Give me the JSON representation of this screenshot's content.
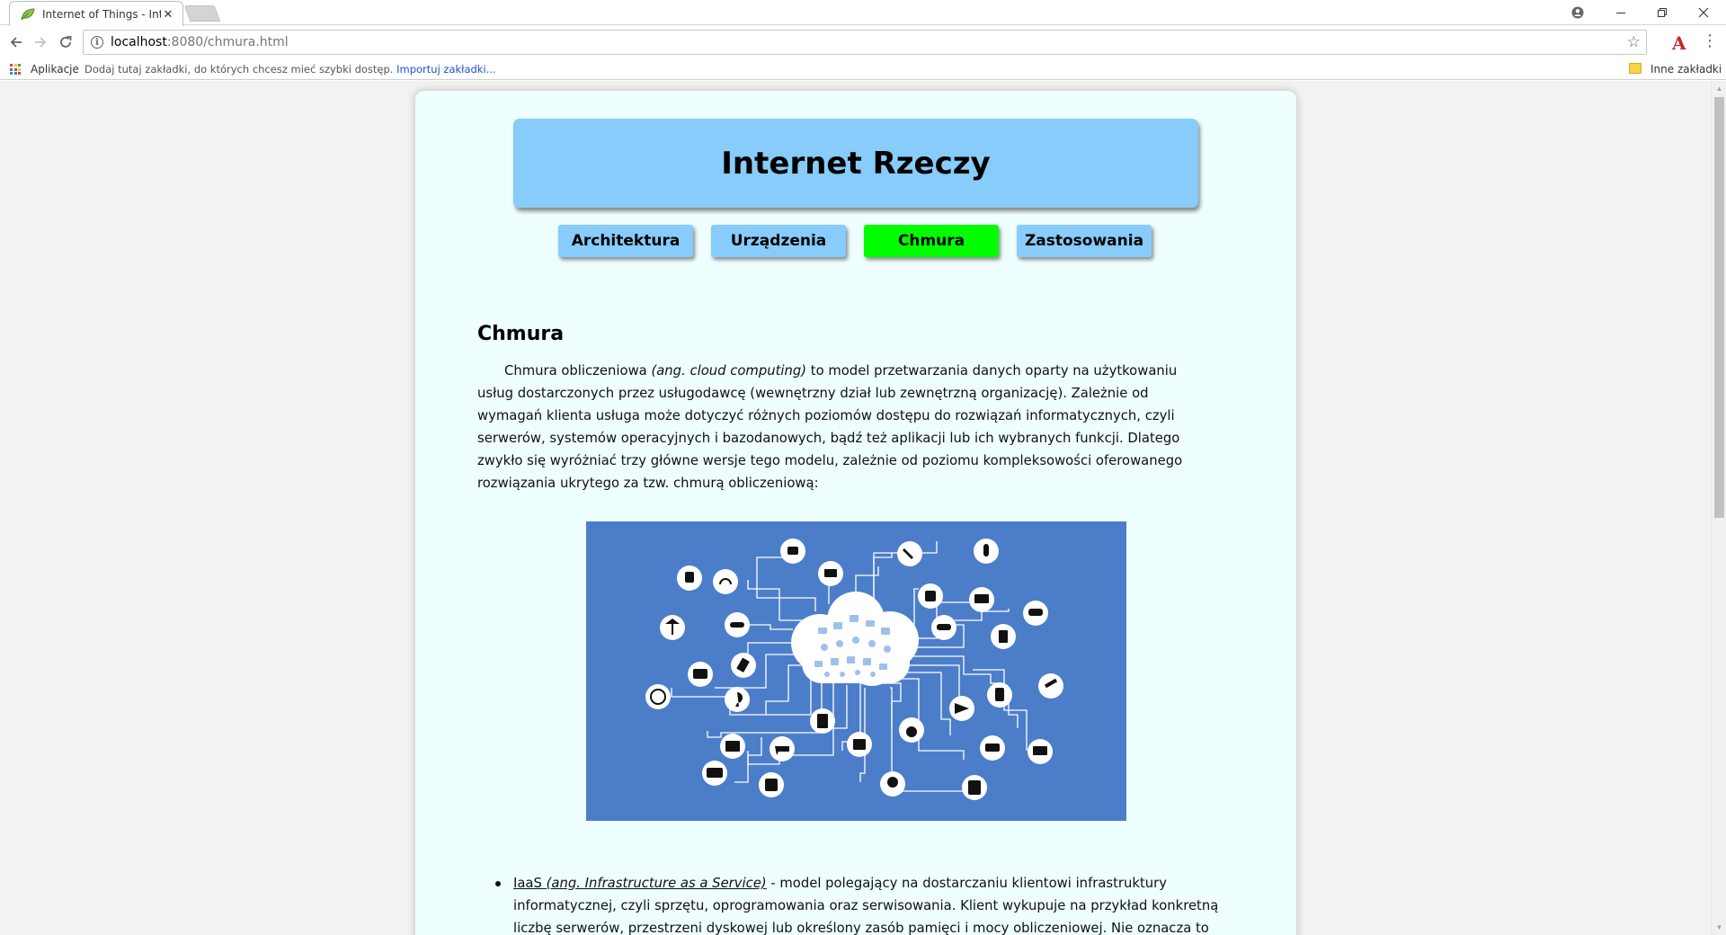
{
  "browser": {
    "tab_title": "Internet of Things - Inter",
    "url_host": "localhost",
    "url_rest": ":8080/chmura.html",
    "bookmarks": {
      "apps_label": "Aplikacje",
      "hint_text": "Dodaj tutaj zakładki, do których chcesz mieć szybki dostęp.",
      "import_link": "Importuj zakładki...",
      "other_label": "Inne zakładki"
    },
    "colors": {
      "import_link": "#1a55c8"
    }
  },
  "site": {
    "title": "Internet Rzeczy",
    "nav": [
      {
        "label": "Architektura",
        "active": false
      },
      {
        "label": "Urządzenia",
        "active": false
      },
      {
        "label": "Chmura",
        "active": true
      },
      {
        "label": "Zastosowania",
        "active": false
      }
    ],
    "colors": {
      "header_bg": "#87ccfa",
      "active_nav": "#00fe00",
      "page_bg": "#effefe",
      "figure_bg": "#4c7dc9"
    }
  },
  "content": {
    "heading": "Chmura",
    "paragraph": {
      "before_em": "Chmura obliczeniowa ",
      "em": "(ang. cloud computing)",
      "after_em": " to model przetwarzania danych oparty na użytkowaniu usług dostarczonych przez usługodawcę (wewnętrzny dział lub zewnętrzną organizację). Zależnie od wymagań klienta usługa może dotyczyć różnych poziomów dostępu do rozwiązań informatycznych, czyli serwerów, systemów operacyjnych i bazodanowych, bądź też aplikacji lub ich wybranych funkcji. Dlatego zwykło się wyróżniać trzy główne wersje tego modelu, zależnie od poziomu kompleksowości oferowanego rozwiązania ukrytego za tzw. chmurą obliczeniową:"
    },
    "list": [
      {
        "term": "IaaS",
        "term_em": "(ang. Infrastructure as a Service)",
        "text": " - model polegający na dostarczaniu klientowi infrastruktury informatycznej, czyli sprzętu, oprogramowania oraz serwisowania. Klient wykupuje na przykład konkretną liczbę serwerów, przestrzeni dyskowej lub określony zasób pamięci i mocy obliczeniowej. Nie oznacza to"
      }
    ]
  }
}
